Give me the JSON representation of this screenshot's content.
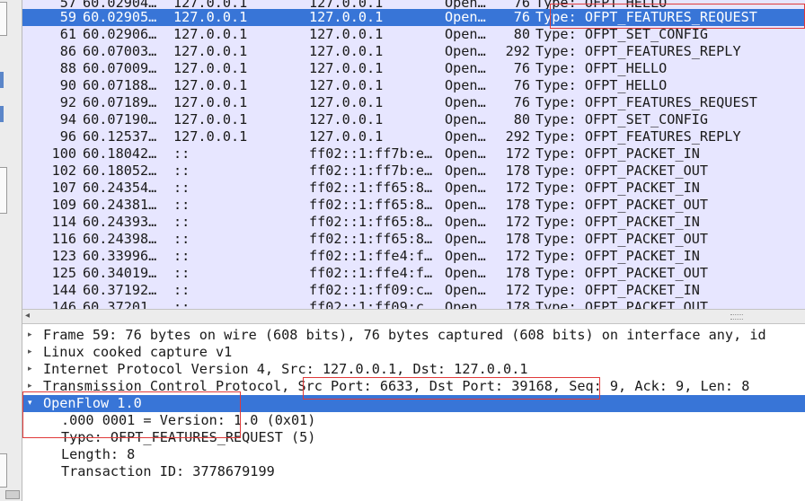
{
  "packet_list": {
    "rows": [
      {
        "no": "57",
        "time": "60.02904…",
        "src": "127.0.0.1",
        "dst": "127.0.0.1",
        "proto": "Open…",
        "len": "76",
        "info": "Type: OFPT_HELLO",
        "selected": false
      },
      {
        "no": "59",
        "time": "60.02905…",
        "src": "127.0.0.1",
        "dst": "127.0.0.1",
        "proto": "Open…",
        "len": "76",
        "info": "Type: OFPT_FEATURES_REQUEST",
        "selected": true
      },
      {
        "no": "61",
        "time": "60.02906…",
        "src": "127.0.0.1",
        "dst": "127.0.0.1",
        "proto": "Open…",
        "len": "80",
        "info": "Type: OFPT_SET_CONFIG",
        "selected": false
      },
      {
        "no": "86",
        "time": "60.07003…",
        "src": "127.0.0.1",
        "dst": "127.0.0.1",
        "proto": "Open…",
        "len": "292",
        "info": "Type: OFPT_FEATURES_REPLY",
        "selected": false
      },
      {
        "no": "88",
        "time": "60.07009…",
        "src": "127.0.0.1",
        "dst": "127.0.0.1",
        "proto": "Open…",
        "len": "76",
        "info": "Type: OFPT_HELLO",
        "selected": false
      },
      {
        "no": "90",
        "time": "60.07188…",
        "src": "127.0.0.1",
        "dst": "127.0.0.1",
        "proto": "Open…",
        "len": "76",
        "info": "Type: OFPT_HELLO",
        "selected": false
      },
      {
        "no": "92",
        "time": "60.07189…",
        "src": "127.0.0.1",
        "dst": "127.0.0.1",
        "proto": "Open…",
        "len": "76",
        "info": "Type: OFPT_FEATURES_REQUEST",
        "selected": false
      },
      {
        "no": "94",
        "time": "60.07190…",
        "src": "127.0.0.1",
        "dst": "127.0.0.1",
        "proto": "Open…",
        "len": "80",
        "info": "Type: OFPT_SET_CONFIG",
        "selected": false
      },
      {
        "no": "96",
        "time": "60.12537…",
        "src": "127.0.0.1",
        "dst": "127.0.0.1",
        "proto": "Open…",
        "len": "292",
        "info": "Type: OFPT_FEATURES_REPLY",
        "selected": false
      },
      {
        "no": "100",
        "time": "60.18042…",
        "src": "::",
        "dst": "ff02::1:ff7b:e…",
        "proto": "Open…",
        "len": "172",
        "info": "Type: OFPT_PACKET_IN",
        "selected": false
      },
      {
        "no": "102",
        "time": "60.18052…",
        "src": "::",
        "dst": "ff02::1:ff7b:e…",
        "proto": "Open…",
        "len": "178",
        "info": "Type: OFPT_PACKET_OUT",
        "selected": false
      },
      {
        "no": "107",
        "time": "60.24354…",
        "src": "::",
        "dst": "ff02::1:ff65:8…",
        "proto": "Open…",
        "len": "172",
        "info": "Type: OFPT_PACKET_IN",
        "selected": false
      },
      {
        "no": "109",
        "time": "60.24381…",
        "src": "::",
        "dst": "ff02::1:ff65:8…",
        "proto": "Open…",
        "len": "178",
        "info": "Type: OFPT_PACKET_OUT",
        "selected": false
      },
      {
        "no": "114",
        "time": "60.24393…",
        "src": "::",
        "dst": "ff02::1:ff65:8…",
        "proto": "Open…",
        "len": "172",
        "info": "Type: OFPT_PACKET_IN",
        "selected": false
      },
      {
        "no": "116",
        "time": "60.24398…",
        "src": "::",
        "dst": "ff02::1:ff65:8…",
        "proto": "Open…",
        "len": "178",
        "info": "Type: OFPT_PACKET_OUT",
        "selected": false
      },
      {
        "no": "123",
        "time": "60.33996…",
        "src": "::",
        "dst": "ff02::1:ffe4:f…",
        "proto": "Open…",
        "len": "172",
        "info": "Type: OFPT_PACKET_IN",
        "selected": false
      },
      {
        "no": "125",
        "time": "60.34019…",
        "src": "::",
        "dst": "ff02::1:ffe4:f…",
        "proto": "Open…",
        "len": "178",
        "info": "Type: OFPT_PACKET_OUT",
        "selected": false
      },
      {
        "no": "144",
        "time": "60.37192…",
        "src": "::",
        "dst": "ff02::1:ff09:c…",
        "proto": "Open…",
        "len": "172",
        "info": "Type: OFPT_PACKET_IN",
        "selected": false
      },
      {
        "no": "146",
        "time": "60.37201…",
        "src": "::",
        "dst": "ff02::1:ff09:c…",
        "proto": "Open…",
        "len": "178",
        "info": "Type: OFPT_PACKET_OUT",
        "selected": false
      }
    ]
  },
  "details": {
    "rows": [
      {
        "text": "Frame 59: 76 bytes on wire (608 bits), 76 bytes captured (608 bits) on interface any, id",
        "expander": "collapsed",
        "child": false,
        "selected": false
      },
      {
        "text": "Linux cooked capture v1",
        "expander": "collapsed",
        "child": false,
        "selected": false
      },
      {
        "text": "Internet Protocol Version 4, Src: 127.0.0.1, Dst: 127.0.0.1",
        "expander": "collapsed",
        "child": false,
        "selected": false
      },
      {
        "text": "Transmission Control Protocol, Src Port: 6633, Dst Port: 39168, Seq: 9, Ack: 9, Len: 8",
        "expander": "collapsed",
        "child": false,
        "selected": false
      },
      {
        "text": "OpenFlow 1.0",
        "expander": "expanded",
        "child": false,
        "selected": true
      },
      {
        "text": ".000 0001 = Version: 1.0 (0x01)",
        "expander": "none",
        "child": true,
        "selected": false
      },
      {
        "text": "Type: OFPT_FEATURES_REQUEST (5)",
        "expander": "none",
        "child": true,
        "selected": false
      },
      {
        "text": "Length: 8",
        "expander": "none",
        "child": true,
        "selected": false
      },
      {
        "text": "Transaction ID: 3778679199",
        "expander": "none",
        "child": true,
        "selected": false
      }
    ]
  },
  "icons": {
    "collapsed": "▸",
    "expanded": "▾",
    "scroll_left": "◂"
  },
  "colors": {
    "selection": "#3875d7",
    "list_background": "#e7e6ff",
    "highlight_box": "#e03a3a"
  }
}
